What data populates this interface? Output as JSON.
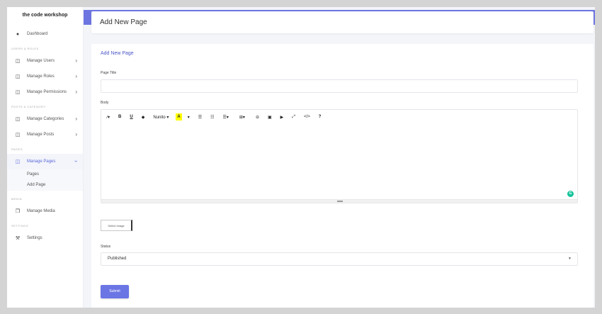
{
  "brand": "the code workshop",
  "sidebar": {
    "dashboard": "Dashboard",
    "sections": {
      "users_roles": "USERS & ROLES",
      "posts_category": "POSTS & CATEGORY",
      "pages": "PAGES",
      "media": "MEDIA",
      "settings": "SETTINGS"
    },
    "items": {
      "manage_users": "Manage Users",
      "manage_roles": "Manage Roles",
      "manage_permissions": "Manage Permissions",
      "manage_categories": "Manage Categories",
      "manage_posts": "Manage Posts",
      "manage_pages": "Manage Pages",
      "manage_media": "Manage Media",
      "settings": "Settings"
    },
    "pages_sub": [
      "Pages",
      "Add Page"
    ]
  },
  "header": {
    "title": "Add New Page"
  },
  "form": {
    "card_title": "Add New Page",
    "page_title_label": "Page Title",
    "page_title_value": "",
    "body_label": "Body",
    "toolbar": {
      "magic": "⁄▾",
      "bold": "B",
      "underline": "U",
      "eraser": "◆",
      "font": "Nunito ▾",
      "color": "A",
      "color_dd": "▾",
      "ul": "☰",
      "ol": "☷",
      "align": "☰▾",
      "table": "⊞▾",
      "link": "⊖",
      "picture": "▣",
      "video": "▶",
      "fullscreen": "⤢",
      "code": "</>",
      "help": "?"
    },
    "select_image_label": "Select Image",
    "status_label": "Status",
    "status_value": "Published",
    "submit_label": "Submit"
  },
  "colors": {
    "accent": "#6b75e4",
    "active_text": "#5b67d8",
    "highlight": "#ffff00",
    "grammarly": "#15c39a"
  }
}
